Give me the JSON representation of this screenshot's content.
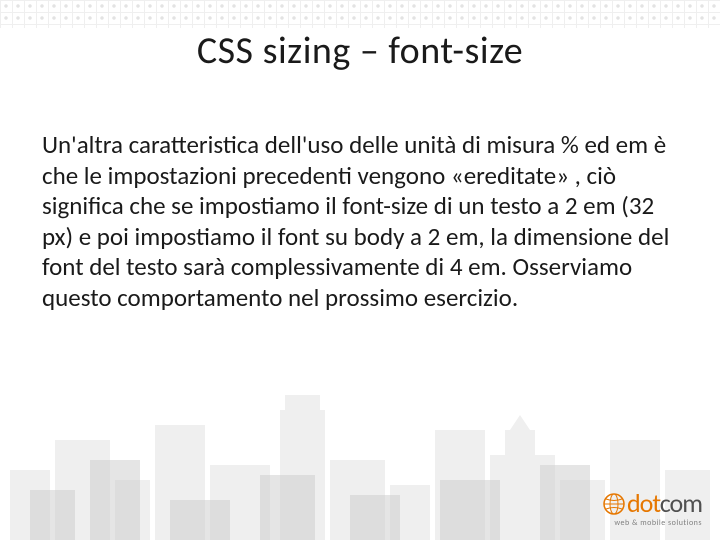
{
  "title": "CSS sizing – font-size",
  "body": "Un'altra caratteristica dell'uso delle unità di misura % ed em è che le impostazioni precedenti vengono «ereditate» , ciò significa che se impostiamo il font-size di un testo a 2 em (32 px) e poi impostiamo il font su body a 2 em, la dimensione del font del testo sarà complessivamente di 4 em. Osserviamo questo comportamento nel prossimo esercizio.",
  "logo": {
    "dot": "dot",
    "com": "com",
    "tagline": "web & mobile solutions"
  }
}
